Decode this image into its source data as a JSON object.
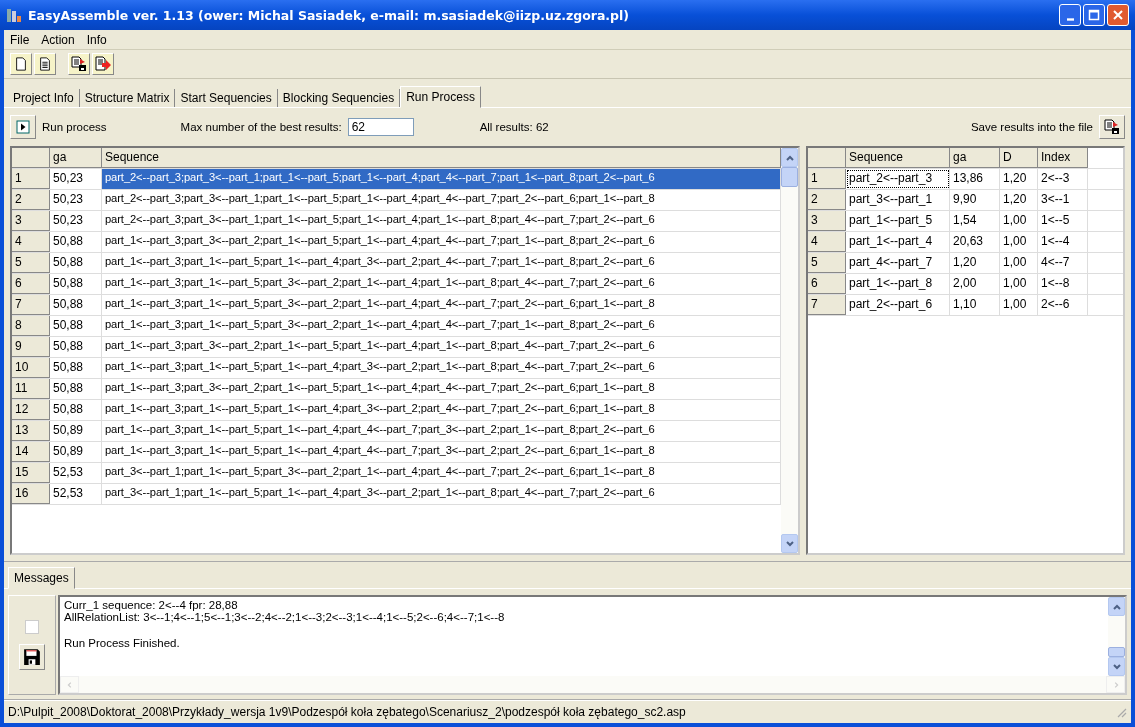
{
  "window": {
    "title": "EasyAssemble ver. 1.13 (ower: Michal Sasiadek, e-mail: m.sasiadek@iizp.uz.zgora.pl)"
  },
  "menu": [
    "File",
    "Action",
    "Info"
  ],
  "tabs": [
    {
      "label": "Project Info",
      "selected": false
    },
    {
      "label": "Structure Matrix",
      "selected": false
    },
    {
      "label": "Start Sequencies",
      "selected": false
    },
    {
      "label": "Blocking Sequencies",
      "selected": false
    },
    {
      "label": "Run Process",
      "selected": true
    }
  ],
  "run_panel": {
    "run_label": "Run process",
    "max_label": "Max number of the best results:",
    "max_value": "62",
    "all_results": "All results: 62",
    "save_label": "Save results into the file"
  },
  "results_table": {
    "columns": [
      "ga",
      "Sequence"
    ],
    "rows": [
      {
        "index": "1",
        "ga": "50,23",
        "sequence": "part_2<--part_3;part_3<--part_1;part_1<--part_5;part_1<--part_4;part_4<--part_7;part_1<--part_8;part_2<--part_6",
        "selected": true
      },
      {
        "index": "2",
        "ga": "50,23",
        "sequence": "part_2<--part_3;part_3<--part_1;part_1<--part_5;part_1<--part_4;part_4<--part_7;part_2<--part_6;part_1<--part_8",
        "selected": false
      },
      {
        "index": "3",
        "ga": "50,23",
        "sequence": "part_2<--part_3;part_3<--part_1;part_1<--part_5;part_1<--part_4;part_1<--part_8;part_4<--part_7;part_2<--part_6",
        "selected": false
      },
      {
        "index": "4",
        "ga": "50,88",
        "sequence": "part_1<--part_3;part_3<--part_2;part_1<--part_5;part_1<--part_4;part_4<--part_7;part_1<--part_8;part_2<--part_6",
        "selected": false
      },
      {
        "index": "5",
        "ga": "50,88",
        "sequence": "part_1<--part_3;part_1<--part_5;part_1<--part_4;part_3<--part_2;part_4<--part_7;part_1<--part_8;part_2<--part_6",
        "selected": false
      },
      {
        "index": "6",
        "ga": "50,88",
        "sequence": "part_1<--part_3;part_1<--part_5;part_3<--part_2;part_1<--part_4;part_1<--part_8;part_4<--part_7;part_2<--part_6",
        "selected": false
      },
      {
        "index": "7",
        "ga": "50,88",
        "sequence": "part_1<--part_3;part_1<--part_5;part_3<--part_2;part_1<--part_4;part_4<--part_7;part_2<--part_6;part_1<--part_8",
        "selected": false
      },
      {
        "index": "8",
        "ga": "50,88",
        "sequence": "part_1<--part_3;part_1<--part_5;part_3<--part_2;part_1<--part_4;part_4<--part_7;part_1<--part_8;part_2<--part_6",
        "selected": false
      },
      {
        "index": "9",
        "ga": "50,88",
        "sequence": "part_1<--part_3;part_3<--part_2;part_1<--part_5;part_1<--part_4;part_1<--part_8;part_4<--part_7;part_2<--part_6",
        "selected": false
      },
      {
        "index": "10",
        "ga": "50,88",
        "sequence": "part_1<--part_3;part_1<--part_5;part_1<--part_4;part_3<--part_2;part_1<--part_8;part_4<--part_7;part_2<--part_6",
        "selected": false
      },
      {
        "index": "11",
        "ga": "50,88",
        "sequence": "part_1<--part_3;part_3<--part_2;part_1<--part_5;part_1<--part_4;part_4<--part_7;part_2<--part_6;part_1<--part_8",
        "selected": false
      },
      {
        "index": "12",
        "ga": "50,88",
        "sequence": "part_1<--part_3;part_1<--part_5;part_1<--part_4;part_3<--part_2;part_4<--part_7;part_2<--part_6;part_1<--part_8",
        "selected": false
      },
      {
        "index": "13",
        "ga": "50,89",
        "sequence": "part_1<--part_3;part_1<--part_5;part_1<--part_4;part_4<--part_7;part_3<--part_2;part_1<--part_8;part_2<--part_6",
        "selected": false
      },
      {
        "index": "14",
        "ga": "50,89",
        "sequence": "part_1<--part_3;part_1<--part_5;part_1<--part_4;part_4<--part_7;part_3<--part_2;part_2<--part_6;part_1<--part_8",
        "selected": false
      },
      {
        "index": "15",
        "ga": "52,53",
        "sequence": "part_3<--part_1;part_1<--part_5;part_3<--part_2;part_1<--part_4;part_4<--part_7;part_2<--part_6;part_1<--part_8",
        "selected": false
      },
      {
        "index": "16",
        "ga": "52,53",
        "sequence": "part_3<--part_1;part_1<--part_5;part_1<--part_4;part_3<--part_2;part_1<--part_8;part_4<--part_7;part_2<--part_6",
        "selected": false
      }
    ]
  },
  "relations_table": {
    "columns": [
      "Sequence",
      "ga",
      "D",
      "Index"
    ],
    "rows": [
      {
        "index": "1",
        "sequence": "part_2<--part_3",
        "ga": "13,86",
        "d": "1,20",
        "relation": "2<--3",
        "focused": true
      },
      {
        "index": "2",
        "sequence": "part_3<--part_1",
        "ga": "9,90",
        "d": "1,20",
        "relation": "3<--1",
        "focused": false
      },
      {
        "index": "3",
        "sequence": "part_1<--part_5",
        "ga": "1,54",
        "d": "1,00",
        "relation": "1<--5",
        "focused": false
      },
      {
        "index": "4",
        "sequence": "part_1<--part_4",
        "ga": "20,63",
        "d": "1,00",
        "relation": "1<--4",
        "focused": false
      },
      {
        "index": "5",
        "sequence": "part_4<--part_7",
        "ga": "1,20",
        "d": "1,00",
        "relation": "4<--7",
        "focused": false
      },
      {
        "index": "6",
        "sequence": "part_1<--part_8",
        "ga": "2,00",
        "d": "1,00",
        "relation": "1<--8",
        "focused": false
      },
      {
        "index": "7",
        "sequence": "part_2<--part_6",
        "ga": "1,10",
        "d": "1,00",
        "relation": "2<--6",
        "focused": false
      }
    ]
  },
  "messages": {
    "tab": "Messages",
    "checked": false,
    "paragraphs": [
      [
        "Curr_1 sequence: 2<--4 fpr: 28,88",
        "AllRelationList: 3<--1;4<--1;5<--1;3<--2;4<--2;1<--3;2<--3;1<--4;1<--5;2<--6;4<--7;1<--8"
      ],
      [
        "Run Process Finished."
      ]
    ]
  },
  "status_bar": "D:\\Pulpit_2008\\Doktorat_2008\\Przykłady_wersja 1v9\\Podzespół koła zębatego\\Scenariusz_2\\podzespół koła zębatego_sc2.asp"
}
